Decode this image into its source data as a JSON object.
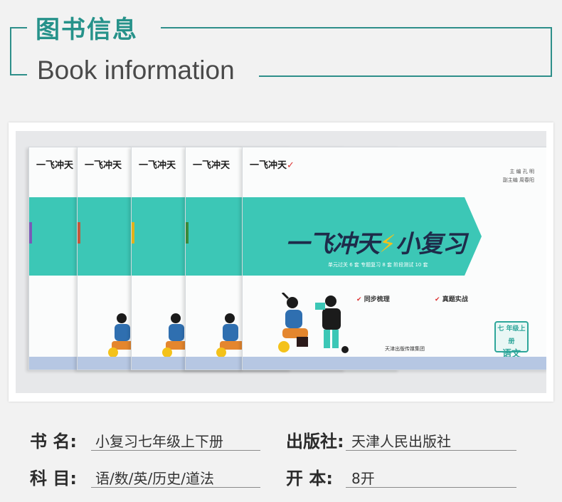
{
  "header": {
    "title_cn": "图书信息",
    "title_en": "Book information",
    "accent_color": "#26928a"
  },
  "product_photo": {
    "books": [
      {
        "logo": "一飞冲天",
        "spine_color": "#c05a3c"
      },
      {
        "logo": "一飞冲天",
        "spine_color": "#e0b21a"
      },
      {
        "logo": "一飞冲天",
        "spine_color": "#3a8a3a"
      },
      {
        "logo": "一飞冲天",
        "spine_color": "#3cc7b6"
      }
    ],
    "front_cover": {
      "logo": "一飞冲天",
      "brand_left": "一飞冲天",
      "brand_right": "小复习",
      "pills": "单元过关 6 套    专题复习 8 套    阶段测试 10 套",
      "credits_1": "主 编  孔 明",
      "credits_2": "副主编  周春阳",
      "tag_1": "同步梳理",
      "tag_2": "真题实战",
      "publisher": "天津出版传媒集团",
      "grade": "七 年级上册",
      "subject": "语文"
    }
  },
  "info": {
    "book_name_label": "书 名:",
    "book_name_value": "小复习七年级上下册",
    "publisher_label": "出版社:",
    "publisher_value": "天津人民出版社",
    "subject_label": "科 目:",
    "subject_value": "语/数/英/历史/道法",
    "format_label": "开 本:",
    "format_value": "8开"
  }
}
